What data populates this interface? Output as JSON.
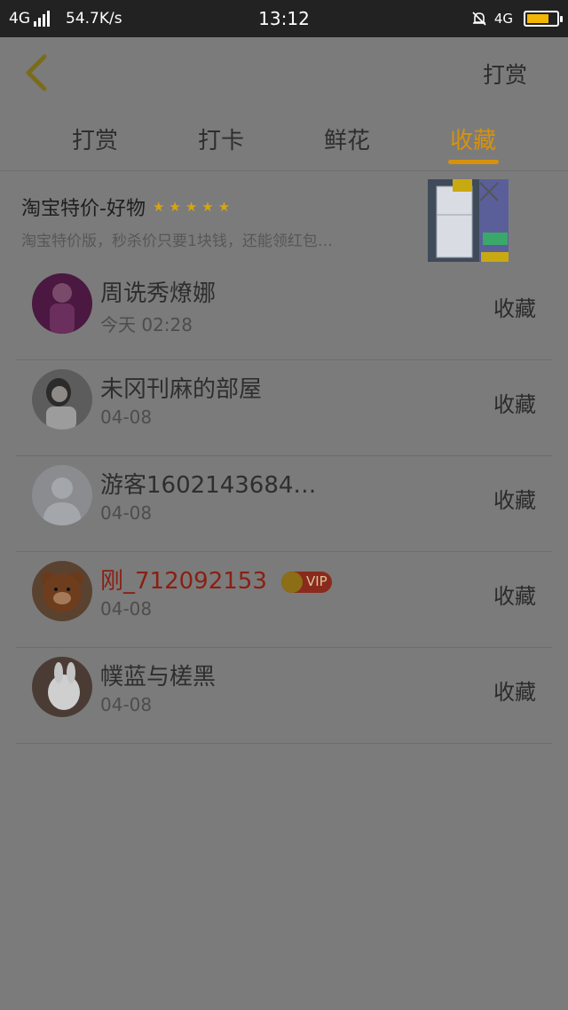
{
  "status_bar": {
    "network": "4G",
    "speed": "54.7K/s",
    "time": "13:12",
    "network_right": "4G",
    "battery_percent": 75
  },
  "header": {
    "right_button": "打赏"
  },
  "tabs": [
    "打赏",
    "打卡",
    "鲜花",
    "收藏"
  ],
  "active_tab_index": 3,
  "ad": {
    "title": "淘宝特价-好物",
    "rating": 5,
    "description": "淘宝特价版，秒杀价只要1块钱，还能领红包…"
  },
  "items": [
    {
      "name": "周诜秀燎娜",
      "time": "今天 02:28",
      "action": "收藏",
      "vip": false
    },
    {
      "name": "未冈刊麻的部屋",
      "time": "04-08",
      "action": "收藏",
      "vip": false
    },
    {
      "name": "游客1602143684…",
      "time": "04-08",
      "action": "收藏",
      "vip": false
    },
    {
      "name": "刚_712092153",
      "time": "04-08",
      "action": "收藏",
      "vip": true,
      "badge": "VIP"
    },
    {
      "name": "幞蓝与槎黑",
      "time": "04-08",
      "action": "收藏",
      "vip": false
    }
  ],
  "colors": {
    "accent": "#d7920b",
    "vip_name": "#8a1f12",
    "overlay_background": "#7b7b7b"
  }
}
